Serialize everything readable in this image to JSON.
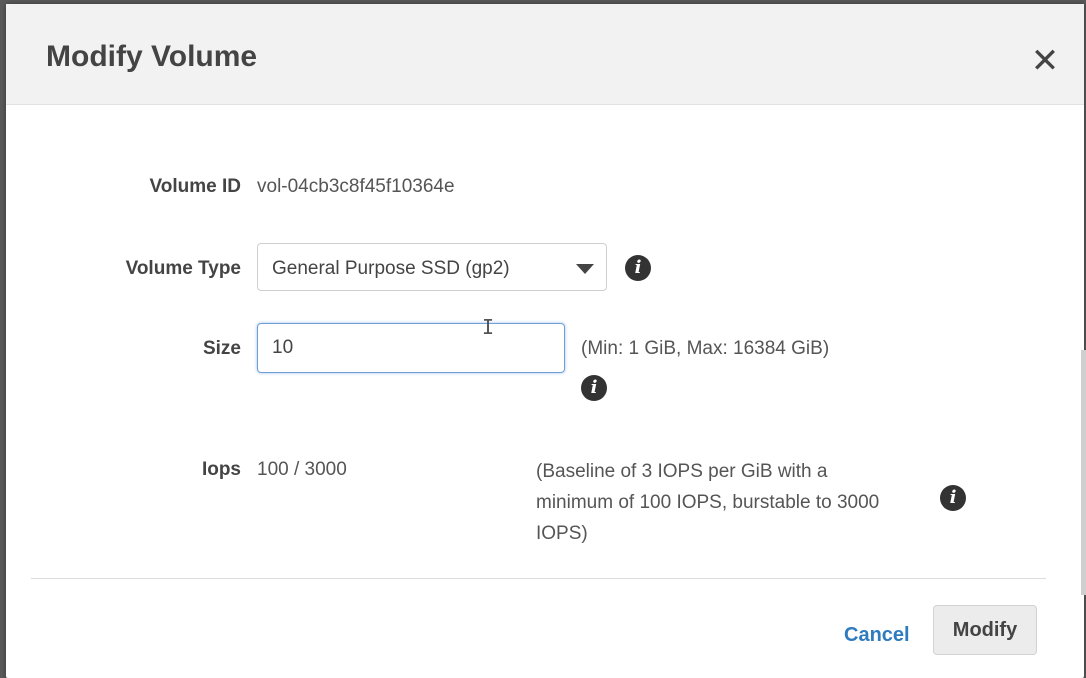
{
  "dialog": {
    "title": "Modify Volume",
    "close_glyph": "✕"
  },
  "form": {
    "volume_id": {
      "label": "Volume ID",
      "value": "vol-04cb3c8f45f10364e"
    },
    "volume_type": {
      "label": "Volume Type",
      "selected": "General Purpose SSD (gp2)"
    },
    "size": {
      "label": "Size",
      "value": "10",
      "hint": "(Min: 1 GiB, Max: 16384 GiB)"
    },
    "iops": {
      "label": "Iops",
      "value": "100 / 3000",
      "description": "(Baseline of 3 IOPS per GiB with a minimum of 100 IOPS, burstable to 3000 IOPS)"
    },
    "info_glyph": "i"
  },
  "footer": {
    "cancel_label": "Cancel",
    "modify_label": "Modify"
  },
  "colors": {
    "link": "#2f7bbf",
    "focus_border": "#6f9fd8"
  },
  "icons": [
    "close-icon",
    "info-icon",
    "chevron-down-icon",
    "text-cursor-icon"
  ]
}
